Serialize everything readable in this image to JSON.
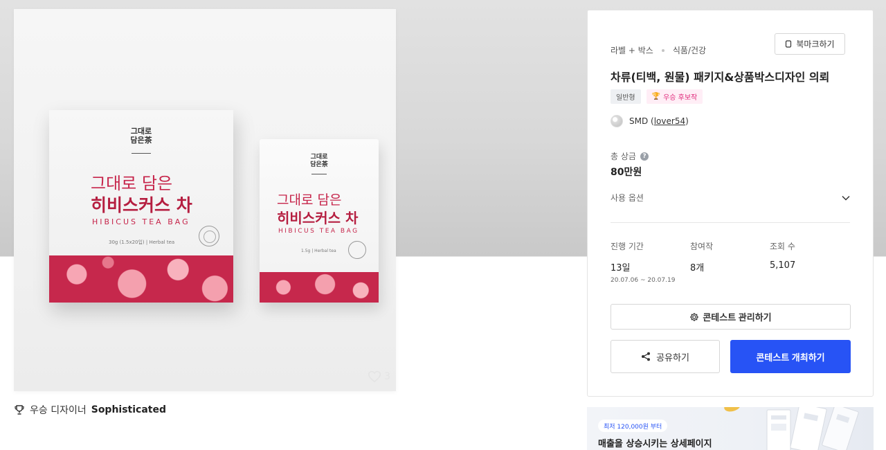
{
  "hero": {
    "box": {
      "brand_line1": "그대로",
      "brand_line2": "담은茶",
      "title1": "그대로 담은",
      "title2": "히비스커스 차",
      "english": "HIBICUS TEA BAG",
      "spec": "30g (1.5x20입) | Herbal tea"
    },
    "pouch": {
      "brand_line1": "그대로",
      "brand_line2": "담은茶",
      "title1": "그대로 담은",
      "title2": "히비스커스 차",
      "english": "HIBICUS TEA BAG",
      "spec": "1.5g | Herbal tea"
    },
    "like_count": "3"
  },
  "winner": {
    "label": "우승 디자이너",
    "name": "Sophisticated"
  },
  "card": {
    "category_main": "라벨 + 박스",
    "category_sub": "식품/건강",
    "bookmark_label": "북마크하기",
    "title": "차류(티백, 원물) 패키지&상품박스디자인 의뢰",
    "badge_type": "일반형",
    "badge_award": "우승 후보작",
    "designer_name": "SMD",
    "designer_handle": "lover54",
    "prize_label": "총 상금",
    "prize_value": "80만원",
    "options_label": "사용 옵션",
    "stats": [
      {
        "label": "진행 기간",
        "value": "13일",
        "sub": "20.07.06 ~ 20.07.19"
      },
      {
        "label": "참여작",
        "value": "8개"
      },
      {
        "label": "조회 수",
        "value": "5,107"
      }
    ],
    "manage_label": "콘테스트 관리하기",
    "share_label": "공유하기",
    "host_label": "콘테스트 개최하기"
  },
  "banner": {
    "tag": "최저 120,000원 부터",
    "text": "매출을 상승시키는 상세페이지"
  },
  "colors": {
    "primary": "#2753f5",
    "award_pink": "#e0287a",
    "tea_red": "#c6244a"
  }
}
